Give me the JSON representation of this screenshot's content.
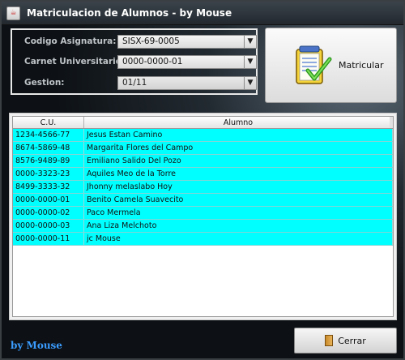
{
  "window": {
    "title": "Matriculacion de Alumnos - by Mouse"
  },
  "form": {
    "asignatura_label": "Codigo Asignatura:",
    "asignatura_value": "SISX-69-0005",
    "carnet_label": "Carnet Universitario:",
    "carnet_value": "0000-0000-01",
    "gestion_label": "Gestion:",
    "gestion_value": "01/11"
  },
  "buttons": {
    "matricular": "Matricular",
    "cerrar": "Cerrar"
  },
  "table": {
    "columns": [
      "C.U.",
      "Alumno"
    ],
    "rows": [
      [
        "1234-4566-77",
        "Jesus Estan Camino"
      ],
      [
        "8674-5869-48",
        "Margarita Flores del Campo"
      ],
      [
        "8576-9489-89",
        "Emiliano Salido Del Pozo"
      ],
      [
        "0000-3323-23",
        "Aquiles Meo de la Torre"
      ],
      [
        "8499-3333-32",
        "Jhonny melaslabo Hoy"
      ],
      [
        "0000-0000-01",
        "Benito Camela Suavecito"
      ],
      [
        "0000-0000-02",
        "Paco Mermela"
      ],
      [
        "0000-0000-03",
        "Ana Liza Melchoto"
      ],
      [
        "0000-0000-11",
        "jc Mouse"
      ]
    ]
  },
  "footer": {
    "brand": "by Mouse"
  },
  "icons": {
    "app": "java-cup-icon",
    "matricular": "notepad-check-icon",
    "cerrar": "door-icon",
    "dropdown": "chevron-down-icon"
  },
  "colors": {
    "row_highlight": "#00ffff",
    "brand_text": "#3b9cff"
  }
}
